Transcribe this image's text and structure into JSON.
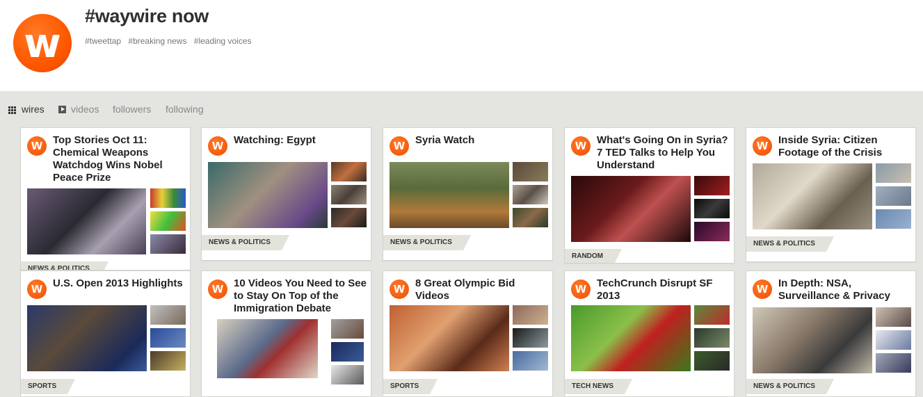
{
  "page": {
    "title": "#waywire now",
    "tags": [
      "#tweettap",
      "#breaking news",
      "#leading voices"
    ]
  },
  "nav": {
    "wires": "wires",
    "videos": "videos",
    "followers": "followers",
    "following": "following"
  },
  "cards": [
    {
      "title": "Top Stories Oct 11: Chemical Weapons Watchdog Wins Nobel Peace Prize",
      "category": "NEWS & POLITICS"
    },
    {
      "title": "Watching: Egypt",
      "category": "NEWS & POLITICS"
    },
    {
      "title": "Syria Watch",
      "category": "NEWS & POLITICS"
    },
    {
      "title": "What's Going On in Syria? 7 TED Talks to Help You Understand",
      "category": "RANDOM"
    },
    {
      "title": "Inside Syria: Citizen Footage of the Crisis",
      "category": "NEWS & POLITICS"
    },
    {
      "title": "U.S. Open 2013 Highlights",
      "category": "SPORTS"
    },
    {
      "title": "10 Videos You Need to See to Stay On Top of the Immigration Debate",
      "category": ""
    },
    {
      "title": "8 Great Olympic Bid Videos",
      "category": "SPORTS"
    },
    {
      "title": "TechCrunch Disrupt SF 2013",
      "category": "TECH NEWS"
    },
    {
      "title": "In Depth: NSA, Surveillance & Privacy",
      "category": "NEWS & POLITICS"
    }
  ],
  "colors": {
    "brand": "#ff5a00",
    "background": "#e4e4e0",
    "badge": "#e3e3dc"
  }
}
